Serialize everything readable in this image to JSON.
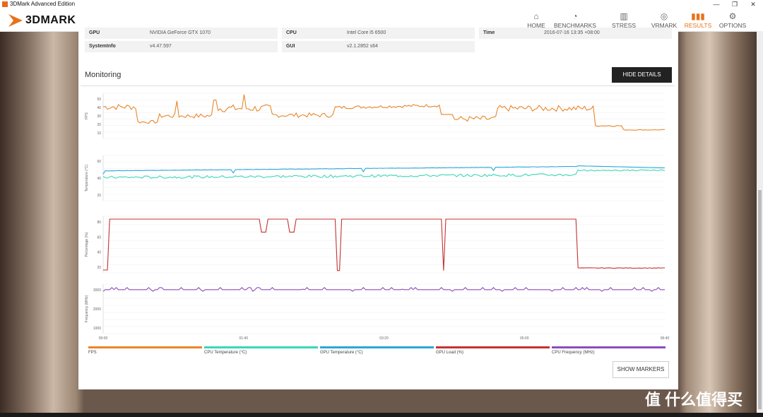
{
  "window": {
    "title": "3DMark Advanced Edition"
  },
  "brand": {
    "name": "3DMARK",
    "accent": "#e8721a"
  },
  "nav": {
    "items": [
      {
        "label": "HOME",
        "icon": "home-icon"
      },
      {
        "label": "BENCHMARKS",
        "icon": "benchmarks-icon"
      },
      {
        "label": "STRESS TESTS",
        "icon": "stress-tests-icon"
      },
      {
        "label": "VRMARK",
        "icon": "vrmark-icon"
      },
      {
        "label": "RESULTS",
        "icon": "results-icon",
        "active": true
      },
      {
        "label": "OPTIONS",
        "icon": "gear-icon"
      }
    ]
  },
  "info": {
    "gpu_key": "GPU",
    "gpu_val": "NVIDIA GeForce GTX 1070",
    "cpu_key": "CPU",
    "cpu_val": "Intel Core i5 6500",
    "time_key": "Time",
    "time_val": "2016-07-16 13:35 +08:00",
    "sysinfo_key": "SystemInfo",
    "sysinfo_val": "v4.47.597",
    "gui_key": "GUI",
    "gui_val": "v2.1.2852 s64"
  },
  "monitoring": {
    "title": "Monitoring",
    "hide_details": "HIDE DETAILS",
    "show_markers": "SHOW MARKERS"
  },
  "chart_data": {
    "type": "line",
    "x_ticks": [
      "00:00",
      "01:40",
      "03:20",
      "05:00",
      "06:40"
    ],
    "panels": [
      {
        "ylabel": "FPS",
        "yticks": [
          "50",
          "40",
          "30",
          "20",
          "10"
        ],
        "ylim": [
          0,
          60
        ]
      },
      {
        "ylabel": "Temperature (°C)",
        "yticks": [
          "60",
          "40",
          "20"
        ],
        "ylim": [
          0,
          70
        ]
      },
      {
        "ylabel": "Percentage (%)",
        "yticks": [
          "80",
          "60",
          "40",
          "20"
        ],
        "ylim": [
          0,
          100
        ]
      },
      {
        "ylabel": "Frequency (MHz)",
        "yticks": [
          "3000",
          "2000",
          "1000"
        ],
        "ylim": [
          0,
          3600
        ]
      }
    ],
    "series": [
      {
        "name": "FPS",
        "color": "#e8862a"
      },
      {
        "name": "CPU Temperature (°C)",
        "color": "#3bd8b4"
      },
      {
        "name": "GPU Temperature (°C)",
        "color": "#2aa7d8"
      },
      {
        "name": "GPU Load (%)",
        "color": "#c43232"
      },
      {
        "name": "CPU Frequency (MHz)",
        "color": "#8e4bc0"
      }
    ]
  },
  "watermark": "值 什么值得买"
}
